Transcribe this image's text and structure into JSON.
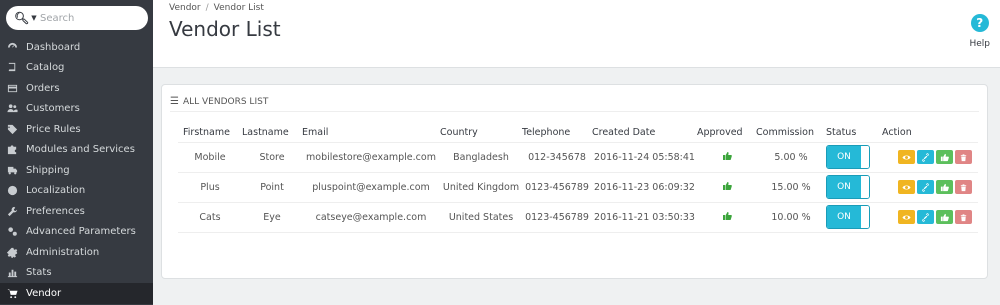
{
  "search": {
    "placeholder": "Search"
  },
  "sidebar": {
    "items": [
      {
        "label": "Dashboard",
        "icon": "dashboard-icon"
      },
      {
        "label": "Catalog",
        "icon": "book-icon"
      },
      {
        "label": "Orders",
        "icon": "credit-card-icon"
      },
      {
        "label": "Customers",
        "icon": "users-icon"
      },
      {
        "label": "Price Rules",
        "icon": "tag-icon"
      },
      {
        "label": "Modules and Services",
        "icon": "puzzle-icon"
      },
      {
        "label": "Shipping",
        "icon": "truck-icon"
      },
      {
        "label": "Localization",
        "icon": "globe-icon"
      },
      {
        "label": "Preferences",
        "icon": "wrench-icon"
      },
      {
        "label": "Advanced Parameters",
        "icon": "cogs-icon"
      },
      {
        "label": "Administration",
        "icon": "gear-icon"
      },
      {
        "label": "Stats",
        "icon": "bar-chart-icon"
      },
      {
        "label": "Vendor",
        "icon": "cart-icon"
      }
    ],
    "active": "Vendor"
  },
  "header": {
    "breadcrumb": [
      "Vendor",
      "Vendor List"
    ],
    "separator": "/",
    "title": "Vendor List",
    "help_label": "Help"
  },
  "panel": {
    "title": "ALL VENDORS LIST",
    "columns": [
      "Firstname",
      "Lastname",
      "Email",
      "Country",
      "Telephone",
      "Created Date",
      "Approved",
      "Commission",
      "Status",
      "Action"
    ],
    "rows": [
      {
        "firstname": "Mobile",
        "lastname": "Store",
        "email": "mobilestore@example.com",
        "country": "Bangladesh",
        "telephone": "012-345678",
        "created": "2016-11-24 05:58:41",
        "approved": true,
        "commission": "5.00 %",
        "status": "ON"
      },
      {
        "firstname": "Plus",
        "lastname": "Point",
        "email": "pluspoint@example.com",
        "country": "United Kingdom",
        "telephone": "0123-456789",
        "created": "2016-11-23 06:09:32",
        "approved": true,
        "commission": "15.00 %",
        "status": "ON"
      },
      {
        "firstname": "Cats",
        "lastname": "Eye",
        "email": "catseye@example.com",
        "country": "United States",
        "telephone": "0123-456789",
        "created": "2016-11-21 03:50:33",
        "approved": true,
        "commission": "10.00 %",
        "status": "ON"
      }
    ]
  },
  "colors": {
    "sidebar_bg": "#363a41",
    "accent": "#25b9d7",
    "view_btn": "#f0b521",
    "approve_btn": "#5cbf5c",
    "delete_btn": "#e08585"
  }
}
